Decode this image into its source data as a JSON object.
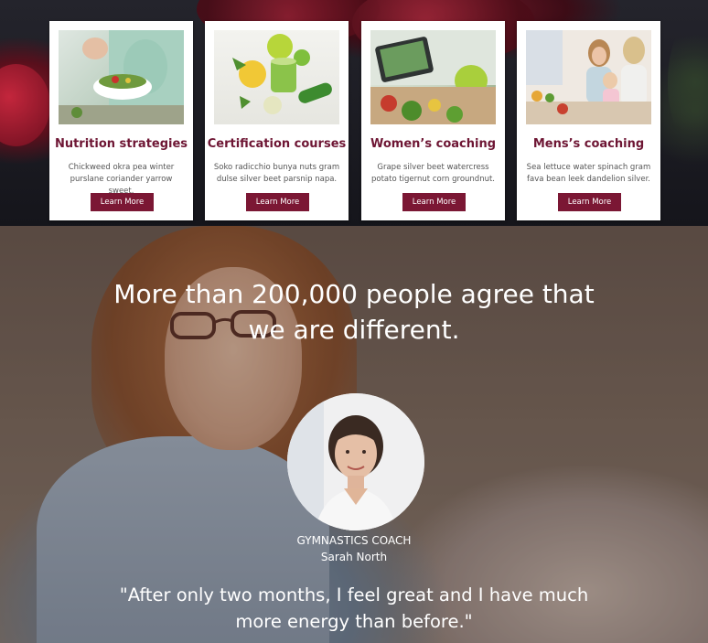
{
  "cards": [
    {
      "title": "Nutrition strategies",
      "description": "Chickweed okra pea winter purslane coriander yarrow sweet.",
      "button": "Learn More"
    },
    {
      "title": "Certification courses",
      "description": "Soko radicchio bunya nuts gram dulse silver beet parsnip napa.",
      "button": "Learn More"
    },
    {
      "title": "Women’s coaching",
      "description": "Grape silver beet watercress potato tigernut corn groundnut.",
      "button": "Learn More"
    },
    {
      "title": "Mens’s coaching",
      "description": "Sea lettuce water spinach gram fava bean leek dandelion silver.",
      "button": "Learn More"
    }
  ],
  "testimonial": {
    "headline_line1": "More than 200,000 people agree that",
    "headline_line2": "we are different.",
    "role": "GYMNASTICS COACH",
    "name": "Sarah North",
    "quote_line1": "\"After only two months, I feel great and I have much",
    "quote_line2": "more energy than before.\""
  },
  "colors": {
    "accent": "#7b1734",
    "card_title": "#6e1634"
  }
}
